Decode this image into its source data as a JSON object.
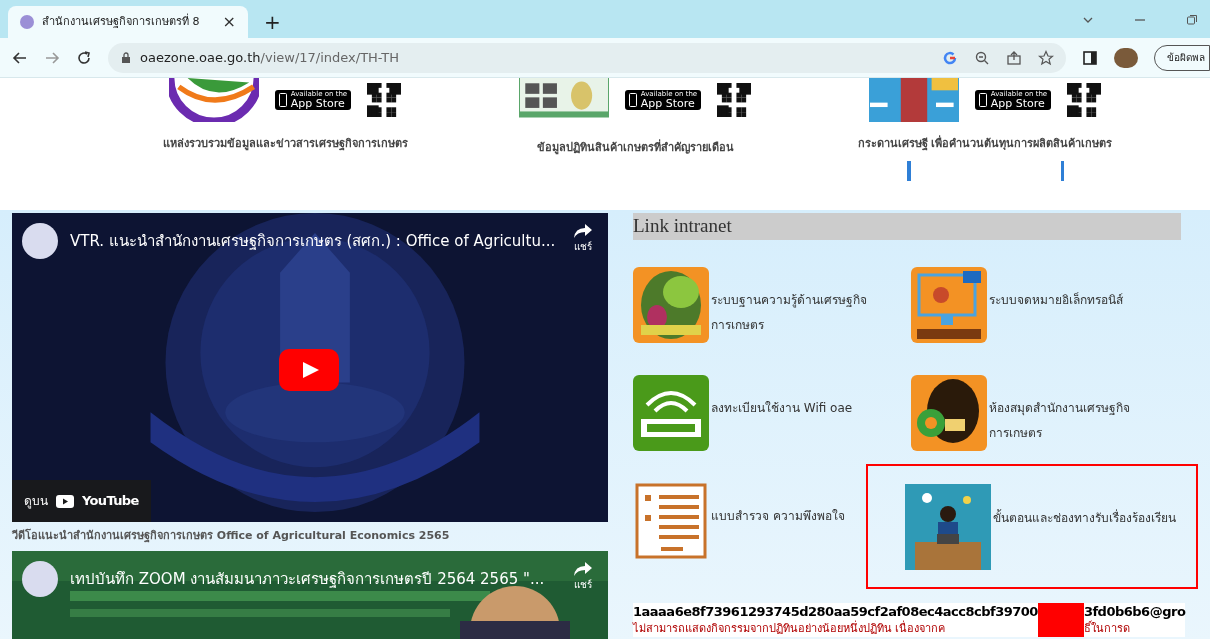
{
  "browser": {
    "tab": {
      "title": "สำนักงานเศรษฐกิจการเกษตรที่ 8",
      "close": "×"
    },
    "new_tab": "+",
    "url_host": "oaezone.oae.go.th",
    "url_path": "/view/17/index/TH-TH",
    "profile_button": "ข้อผิดพล"
  },
  "apps": [
    {
      "caption": "แหล่งรวบรวมข้อมูลและข่าวสารเศรษฐกิจการเกษตร",
      "badge_small": "Available on the",
      "badge_large": "App Store"
    },
    {
      "caption": "ข้อมูลปฏิทินสินค้าเกษตรที่สำคัญรายเดือน",
      "badge_small": "Available on the",
      "badge_large": "App Store"
    },
    {
      "caption": "กระดานเศรษฐี เพื่อคำนวนต้นทุนการผลิตสินค้าเกษตร",
      "badge_small": "Available on the",
      "badge_large": "App Store"
    }
  ],
  "videos": [
    {
      "title": "VTR. แนะนำสำนักงานเศรษฐกิจการเกษตร (สศก.) : Office of Agricultu...",
      "share": "แชร์",
      "watch_on": "ดูบน",
      "youtube": "YouTube"
    },
    {
      "title": "เทปบันทึก ZOOM งานสัมมนาภาวะเศรษฐกิจการเกษตรปี 2564 2565 \"...",
      "share": "แชร์"
    }
  ],
  "video_caption": "วีดีโอแนะนำสำนักงานเศรษฐกิจการเกษตร Office of Agricultural Economics 2565",
  "link_intranet": {
    "title": "Link intranet",
    "items": [
      {
        "label": "ระบบฐานความรู้ด้านเศรษฐกิจการเกษตร",
        "highlighted": false
      },
      {
        "label": "ระบบจดหมายอิเล็กทรอนิส์",
        "highlighted": false
      },
      {
        "label": "ลงทะเบียนใช้งาน Wifi oae",
        "highlighted": false
      },
      {
        "label": "ห้องสมุดสำนักงานเศรษฐกิจการเกษตร",
        "highlighted": false
      },
      {
        "label": "แบบสำรวจ ความพึงพอใจ",
        "highlighted": false
      },
      {
        "label": "ขั้นตอนและช่องทางรับเรื่องร้องเรียน",
        "highlighted": true
      }
    ]
  },
  "calendar": {
    "id_start": "1aaaa6e8f73961293745d280aa59cf2af08ec4acc8cbf39700",
    "id_end": "3fd0b6b6@gro",
    "error_start": "ไม่สามารถแสดงกิจกรรมจากปฏิทินอย่างน้อยหนึ่งปฏิทิน เนื่องจากค",
    "error_end": "ธิ์ในการด"
  }
}
